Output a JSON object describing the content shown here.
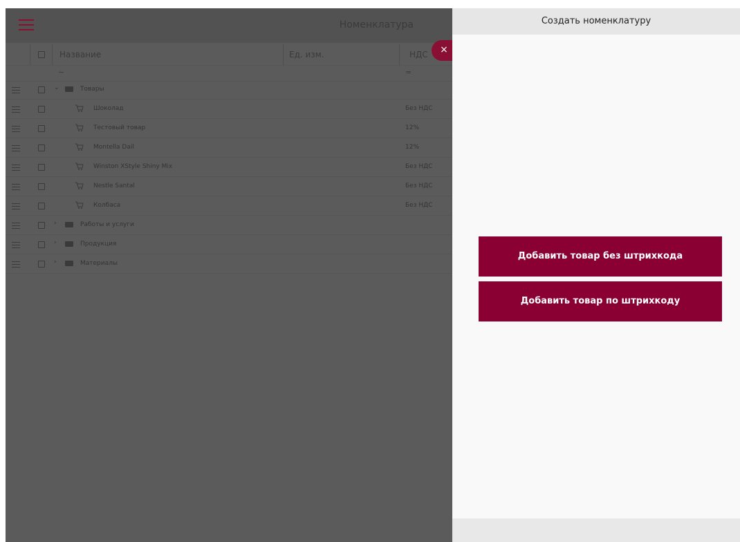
{
  "colors": {
    "accent": "#8a0033",
    "overlay_panel": "#5b5b5b",
    "side_panel_bg": "#f9f9f9"
  },
  "header": {
    "title": "Номенклатура",
    "menu_icon": "hamburger-icon"
  },
  "table": {
    "columns": {
      "name": "Название",
      "unit": "Ед. изм.",
      "vat": "НДС"
    },
    "filters": {
      "name": "∼",
      "vat": "="
    },
    "rows": [
      {
        "type": "folder",
        "expanded": true,
        "name": "Товары",
        "vat": ""
      },
      {
        "type": "item",
        "name": "Шоколад",
        "vat": "Без НДС"
      },
      {
        "type": "item",
        "name": "Тестовый товар",
        "vat": "12%"
      },
      {
        "type": "item",
        "name": "Montella Dail",
        "vat": "12%"
      },
      {
        "type": "item",
        "name": "Winston XStyle Shiny Mix",
        "vat": "Без НДС"
      },
      {
        "type": "item",
        "name": "Nestle Santal",
        "vat": "Без НДС"
      },
      {
        "type": "item",
        "name": "Колбаса",
        "vat": "Без НДС"
      },
      {
        "type": "folder",
        "expanded": false,
        "name": "Работы и услуги",
        "vat": ""
      },
      {
        "type": "folder",
        "expanded": false,
        "name": "Продукция",
        "vat": ""
      },
      {
        "type": "folder",
        "expanded": false,
        "name": "Материалы",
        "vat": ""
      }
    ]
  },
  "close_label": "×",
  "panel": {
    "title": "Создать номенклатуру",
    "add_without_barcode": "Добавить товар без штрихкода",
    "add_by_barcode": "Добавить товар по штрихкоду"
  }
}
